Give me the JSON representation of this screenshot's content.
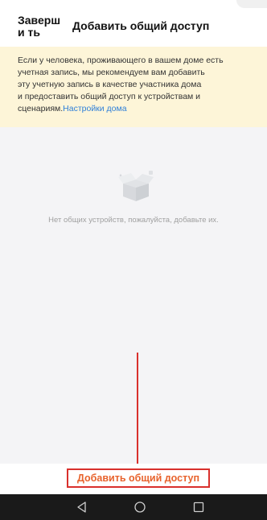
{
  "header": {
    "done_label": "Заверши ть",
    "title": "Добавить общий доступ"
  },
  "banner": {
    "lines": [
      "Если у человека, проживающего в вашем доме есть",
      "учетная запись, мы рекомендуем вам добавить",
      "эту учетную запись в качестве участника дома",
      "и предоставить общий доступ к устройствам и"
    ],
    "last_line_text": "сценариям.",
    "link_text": "Настройки дома"
  },
  "empty_state": {
    "icon": "empty-box-icon",
    "message": "Нет общих устройств, пожалуйста, добавьте их."
  },
  "action": {
    "add_share_label": "Добавить общий доступ"
  },
  "navbar": {
    "icons": [
      "back-icon",
      "home-icon",
      "recent-apps-icon"
    ]
  },
  "colors": {
    "banner_bg": "#fdf5d8",
    "link": "#2f7fd9",
    "action_text": "#e8622c",
    "highlight": "#d9302c",
    "navbar_bg": "#1a1a1a"
  }
}
